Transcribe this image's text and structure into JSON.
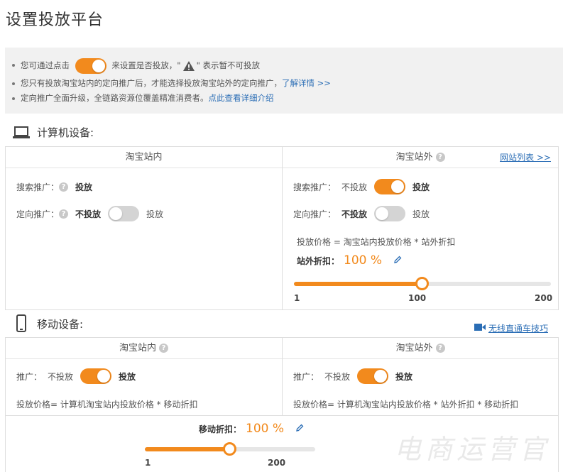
{
  "title": "设置投放平台",
  "notice": {
    "line1_before": "您可通过点击",
    "line1_after": "来设置是否投放，\"",
    "line1_end": "\" 表示暂不可投放",
    "line2_text": "您只有投放淘宝站内的定向推广后，才能选择投放淘宝站外的定向推广，",
    "line2_link": "了解详情 >>",
    "line3_text": "定向推广全面升级，全链路资源位覆盖精准消费者。",
    "line3_link": "点此查看详细介绍"
  },
  "computer": {
    "heading": "计算机设备:",
    "inside": {
      "header": "淘宝站内",
      "search_label": "搜索推广：",
      "search_state": "投放",
      "target_label": "定向推广：",
      "target_off": "不投放",
      "target_on": "投放",
      "target_enabled": false
    },
    "outside": {
      "header": "淘宝站外",
      "site_list_link": "网站列表 >>",
      "search_label": "搜索推广：",
      "search_off": "不投放",
      "search_on": "投放",
      "search_enabled": true,
      "target_label": "定向推广：",
      "target_off": "不投放",
      "target_on": "投放",
      "target_enabled": false,
      "price_formula": "投放价格 = 淘宝站内投放价格 * 站外折扣",
      "discount_label": "站外折扣：",
      "discount_value": "100 %",
      "slider_min": "1",
      "slider_mid": "100",
      "slider_max": "200",
      "slider_value": 100
    }
  },
  "mobile": {
    "heading": "移动设备:",
    "tutorial_link": "无线直通车技巧",
    "inside": {
      "header": "淘宝站内",
      "promo_label": "推广：",
      "promo_off": "不投放",
      "promo_on": "投放",
      "promo_enabled": true,
      "price_formula": "投放价格= 计算机淘宝站内投放价格 * 移动折扣"
    },
    "outside": {
      "header": "淘宝站外",
      "promo_label": "推广：",
      "promo_off": "不投放",
      "promo_on": "投放",
      "promo_enabled": true,
      "price_formula": "投放价格= 计算机淘宝站内投放价格 * 站外折扣 * 移动折扣"
    },
    "discount_label": "移动折扣：",
    "discount_value": "100 %",
    "slider_min": "1",
    "slider_max": "200",
    "slider_value": 100
  },
  "watermark": "电商运营官",
  "colors": {
    "accent": "#f28a1d",
    "link": "#2a6db5"
  }
}
